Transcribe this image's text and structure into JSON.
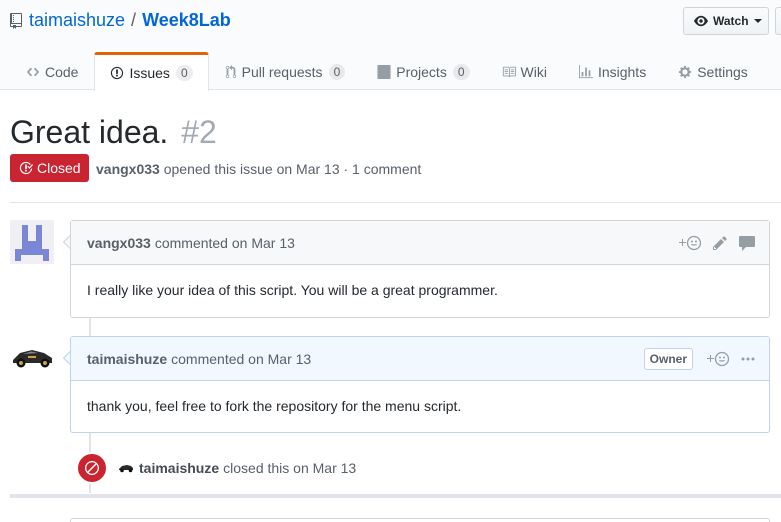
{
  "repo": {
    "owner": "taimaishuze",
    "separator": "/",
    "name": "Week8Lab"
  },
  "watch": {
    "label": "Watch"
  },
  "tabs": [
    {
      "label": "Code",
      "icon": "code-icon"
    },
    {
      "label": "Issues",
      "count": "0",
      "icon": "issue-opened-icon"
    },
    {
      "label": "Pull requests",
      "count": "0",
      "icon": "git-pull-request-icon"
    },
    {
      "label": "Projects",
      "count": "0",
      "icon": "project-icon"
    },
    {
      "label": "Wiki",
      "icon": "book-icon"
    },
    {
      "label": "Insights",
      "icon": "graph-icon"
    },
    {
      "label": "Settings",
      "icon": "gear-icon"
    }
  ],
  "issue": {
    "title": "Great idea.",
    "number": "#2",
    "state": "Closed",
    "author": "vangx033",
    "meta_rest": "opened this issue on Mar 13 · 1 comment"
  },
  "comments": [
    {
      "author": "vangx033",
      "action": "commented on Mar 13",
      "body": "I really like your idea of this script. You will be a great programmer."
    },
    {
      "author": "taimaishuze",
      "action": "commented on Mar 13",
      "badge": "Owner",
      "body": "thank you, feel free to fork the repository for the menu script."
    }
  ],
  "event": {
    "author": "taimaishuze",
    "text": "closed this on Mar 13"
  },
  "colors": {
    "closed": "#cb2431",
    "link": "#0366d6",
    "selected_tab": "#e36209",
    "owner_header": "#f1f8ff"
  }
}
